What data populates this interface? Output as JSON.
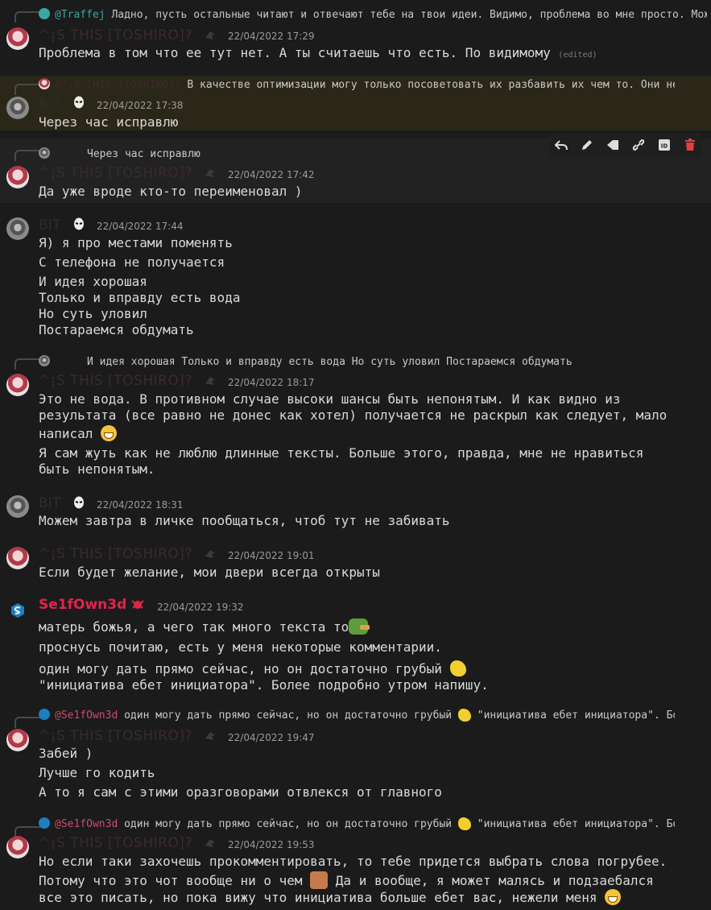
{
  "messages": [
    {
      "reply": {
        "author": "@Traffej",
        "text": "Ладно, пусть остальные читают и отвечают тебе на твои идеи. Видимо, проблема во мне просто. Мож…"
      },
      "author": "^¡S THIS [TOSHIRO]?",
      "time": "22/04/2022 17:29",
      "lines": [
        "Проблема в том что ее тут нет. А ты считаешь что есть. По видимому"
      ],
      "edited": "(edited)"
    },
    {
      "reply": {
        "author": "@^¡S THIS [TOSHIRO]?",
        "text": "В качестве оптимизации могу только посоветовать их разбавить их чем то. Они не до…"
      },
      "author": "BIT",
      "time": "22/04/2022 17:38",
      "lines": [
        "Через час исправлю"
      ]
    },
    {
      "reply": {
        "author": "",
        "text": "Через час исправлю"
      },
      "author": "^¡S THIS [TOSHIRO]?",
      "time": "22/04/2022 17:42",
      "lines": [
        "Да уже вроде кто-то переименовал )"
      ]
    },
    {
      "author": "BIT",
      "time": "22/04/2022 17:44",
      "lines": [
        "Я) я про местами поменять",
        "С телефона не получается",
        "И идея хорошая",
        "Только и вправду есть вода",
        "Но суть уловил",
        "Постараемся обдумать"
      ]
    },
    {
      "reply": {
        "author": "",
        "text": "И идея хорошая Только и вправду есть вода Но суть уловил Постараемся обдумать"
      },
      "author": "^¡S THIS [TOSHIRO]?",
      "time": "22/04/2022 18:17",
      "lines": [
        "Это не вода. В противном случае высоки шансы быть непонятым. И как видно из",
        "результата (все равно не донес как хотел) получается не раскрыл как следует, мало",
        "написал",
        "Я сам жуть как не люблю длинные тексты. Больше этого, правда, мне не нравиться",
        "быть непонятым."
      ]
    },
    {
      "author": "BIT",
      "time": "22/04/2022 18:31",
      "lines": [
        "Можем завтра в личке пообщаться, чтоб тут не забивать"
      ]
    },
    {
      "author": "^¡S THIS [TOSHIRO]?",
      "time": "22/04/2022 19:01",
      "lines": [
        "Если будет желание, мои двери всегда открыты"
      ]
    },
    {
      "author": "Se1fOwn3d",
      "time": "22/04/2022 19:32",
      "lines": [
        "матерь божья, а чего так много текста то",
        "проснусь почитаю, есть у меня некоторые комментарии.",
        "один могу дать прямо сейчас, но он достаточно грубый",
        "\"инициатива ебет инициатора\". Более подробно утром напишу."
      ]
    },
    {
      "reply": {
        "author": "@Se1fOwn3d",
        "text": "один могу дать прямо сейчас, но он достаточно грубый",
        "text2": "\"инициатива ебет инициатора\". Бол…"
      },
      "author": "^¡S THIS [TOSHIRO]?",
      "time": "22/04/2022 19:47",
      "lines": [
        "Забей )",
        "Лучше го кодить",
        "А то я сам с этими оразговорами отвлекся от главного"
      ]
    },
    {
      "reply": {
        "author": "@Se1fOwn3d",
        "text": "один могу дать прямо сейчас, но он достаточно грубый",
        "text2": "\"инициатива ебет инициатора\". Бол…"
      },
      "author": "^¡S THIS [TOSHIRO]?",
      "time": "22/04/2022 19:53",
      "lines": [
        "Но если таки захочешь прокомментировать, то тебе придется выбрать слова погрубее.",
        "Потому что это чот вообще ни о чем",
        "Да и вообще, я может малясь и подзаебался",
        "все это писать, но пока вижу что инициатива  больше ебет вас, нежели меня"
      ]
    }
  ],
  "actions": [
    "reply-icon",
    "edit-icon",
    "pin-icon",
    "link-icon",
    "id-icon",
    "delete-icon"
  ],
  "colors": {
    "background": "#1b1b1c",
    "mention_highlight": "#2b2718",
    "self_name": "#e0244a",
    "delete": "#e04040"
  }
}
